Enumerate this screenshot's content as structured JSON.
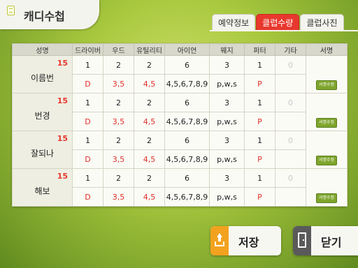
{
  "header": {
    "title": "캐디수첩",
    "tabs": [
      {
        "label": "예약정보",
        "active": false
      },
      {
        "label": "클럽수량",
        "active": true
      },
      {
        "label": "클럽사진",
        "active": false
      }
    ]
  },
  "table": {
    "headers": [
      "성명",
      "드라이버",
      "우드",
      "유틸리티",
      "아이언",
      "웨지",
      "퍼터",
      "기타",
      "서명"
    ],
    "players": [
      {
        "name": "이름번",
        "number": "15",
        "count": [
          "1",
          "2",
          "2",
          "6",
          "3",
          "1",
          "0"
        ],
        "detail": [
          "D",
          "3,5",
          "4,5",
          "4,5,6,7,8,9",
          "p,w,s",
          "P",
          ""
        ],
        "sign_label": "서명수정"
      },
      {
        "name": "번경",
        "number": "15",
        "count": [
          "1",
          "2",
          "2",
          "6",
          "3",
          "1",
          "0"
        ],
        "detail": [
          "D",
          "3,5",
          "4,5",
          "4,5,6,7,8,9",
          "p,w,s",
          "P",
          ""
        ],
        "sign_label": "서명수정"
      },
      {
        "name": "잘되나",
        "number": "15",
        "count": [
          "1",
          "2",
          "2",
          "6",
          "3",
          "1",
          "0"
        ],
        "detail": [
          "D",
          "3,5",
          "4,5",
          "4,5,6,7,8,9",
          "p,w,s",
          "P",
          ""
        ],
        "sign_label": "서명수정"
      },
      {
        "name": "해보",
        "number": "15",
        "count": [
          "1",
          "2",
          "2",
          "6",
          "3",
          "1",
          "0"
        ],
        "detail": [
          "D",
          "3,5",
          "4,5",
          "4,5,6,7,8,9",
          "p,w,s",
          "P",
          ""
        ],
        "sign_label": "서명수정"
      }
    ]
  },
  "buttons": {
    "save_label": "저장",
    "close_label": "닫기"
  },
  "icons": {
    "title": "document-icon",
    "save": "upload-tray-icon",
    "close": "door-exit-icon"
  },
  "colors": {
    "accent_red": "#e8382e",
    "save_icon_bg": "#f2a21e",
    "close_icon_bg": "#5a5a5a",
    "sign_button": "#7ea52c"
  }
}
